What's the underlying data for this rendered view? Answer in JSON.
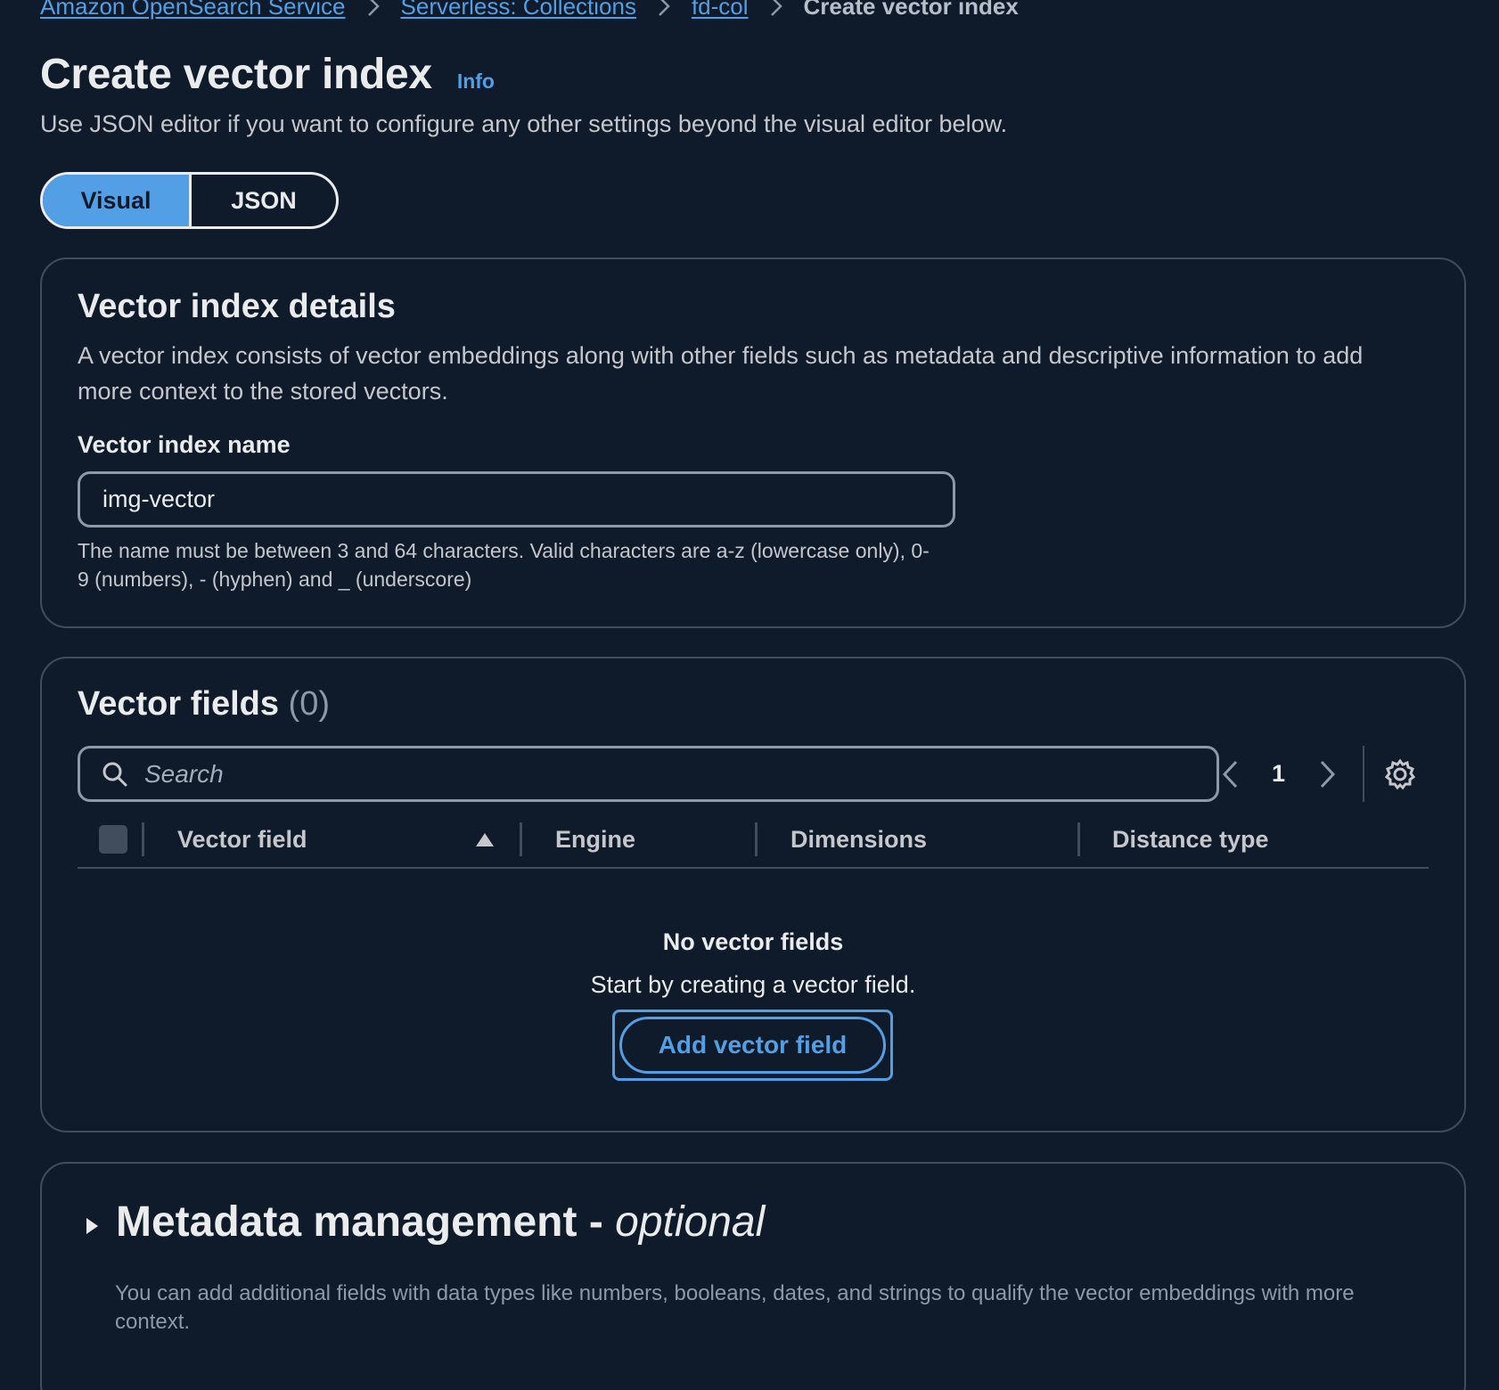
{
  "breadcrumb": {
    "items": [
      "Amazon OpenSearch Service",
      "Serverless: Collections",
      "fd-col"
    ],
    "current": "Create vector index"
  },
  "header": {
    "title": "Create vector index",
    "info_label": "Info",
    "description": "Use JSON editor if you want to configure any other settings beyond the visual editor below."
  },
  "editor_toggle": {
    "options": [
      "Visual",
      "JSON"
    ],
    "selected": "Visual"
  },
  "details": {
    "title": "Vector index details",
    "description": "A vector index consists of vector embeddings along with other fields such as metadata and descriptive information to add more context to the stored vectors.",
    "name_label": "Vector index name",
    "name_value": "img-vector",
    "constraint": "The name must be between 3 and 64 characters. Valid characters are a-z (lowercase only), 0-9 (numbers), - (hyphen) and _ (underscore)"
  },
  "vector_fields": {
    "title": "Vector fields",
    "count": "(0)",
    "search_placeholder": "Search",
    "page": "1",
    "columns": [
      "Vector field",
      "Engine",
      "Dimensions",
      "Distance type"
    ],
    "empty_title": "No vector fields",
    "empty_desc": "Start by creating a vector field.",
    "add_button": "Add vector field"
  },
  "metadata": {
    "title": "Metadata management -",
    "optional": "optional",
    "description": "You can add additional fields with data types like numbers, booleans, dates, and strings to qualify the vector embeddings with more context."
  },
  "colors": {
    "background": "#0f1b2a",
    "accent": "#539fe5",
    "border": "#414d5c",
    "text": "#c6c6cd",
    "heading": "#e9ebed"
  },
  "icons": [
    "chevron-right-icon",
    "search-icon",
    "chevron-left-icon",
    "gear-icon",
    "sort-ascending-icon",
    "caret-right-icon"
  ]
}
